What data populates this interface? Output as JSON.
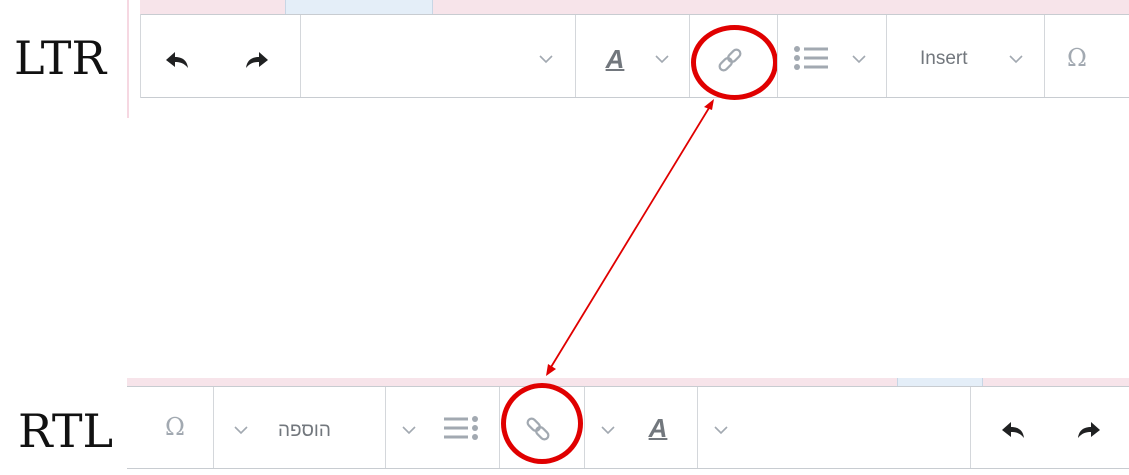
{
  "labels": {
    "ltr": "LTR",
    "rtl": "RTL"
  },
  "ltr_toolbar": {
    "buttons": [
      "undo-icon",
      "redo-icon",
      "format-dropdown",
      "text-style-icon",
      "link-icon",
      "list-icon",
      "insert-menu",
      "special-character-icon"
    ],
    "insert_label": "Insert",
    "omega": "Ω",
    "style_letter": "A"
  },
  "rtl_toolbar": {
    "buttons": [
      "special-character-icon",
      "insert-menu",
      "list-icon",
      "link-icon",
      "text-style-icon",
      "format-dropdown",
      "undo-icon",
      "redo-icon"
    ],
    "insert_label": "הוספה",
    "omega": "Ω",
    "style_letter": "A"
  },
  "annotation": {
    "highlight_color": "#e00000",
    "arrow_color": "#e00000"
  }
}
